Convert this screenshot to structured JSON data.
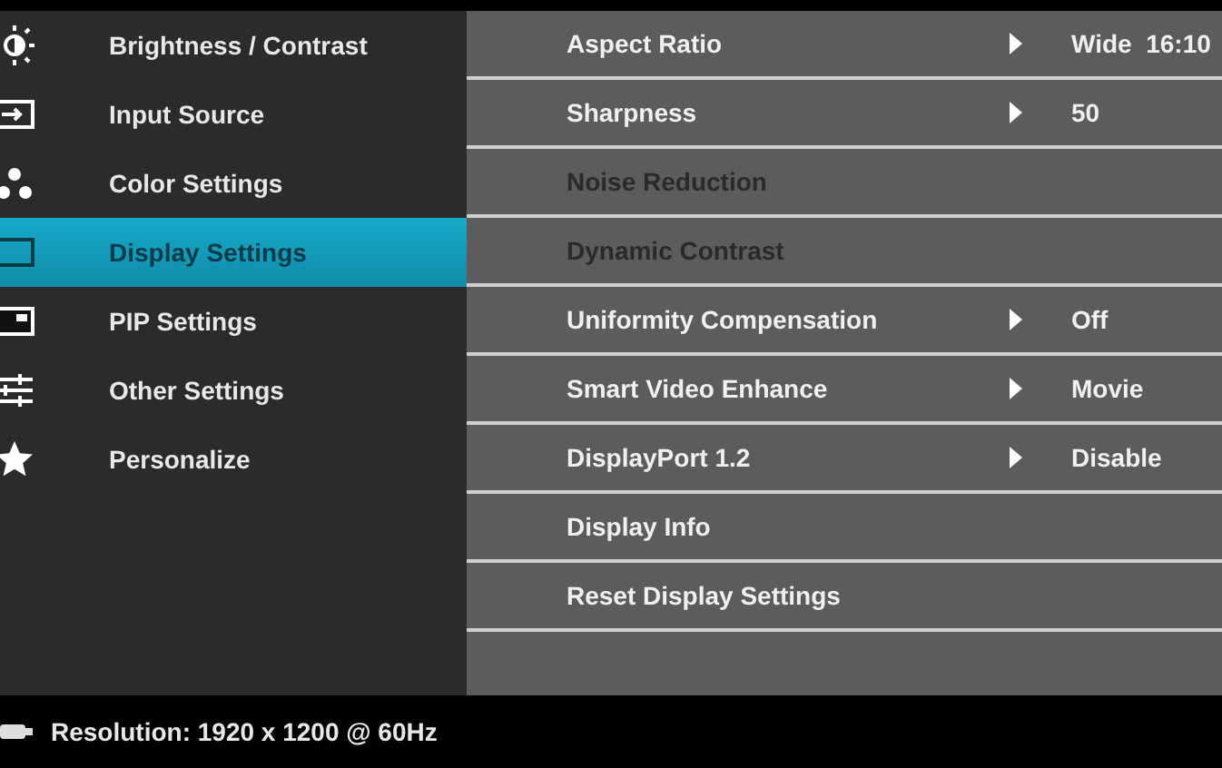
{
  "menu": [
    {
      "label": "Brightness / Contrast",
      "kind": "brightness",
      "selected": false
    },
    {
      "label": "Input Source",
      "kind": "input",
      "selected": false
    },
    {
      "label": "Color Settings",
      "kind": "color",
      "selected": false
    },
    {
      "label": "Display Settings",
      "kind": "display",
      "selected": true
    },
    {
      "label": "PIP Settings",
      "kind": "pip",
      "selected": false
    },
    {
      "label": "Other Settings",
      "kind": "other",
      "selected": false
    },
    {
      "label": "Personalize",
      "kind": "personalize",
      "selected": false
    }
  ],
  "settings": [
    {
      "label": "Aspect Ratio",
      "kind": "option",
      "value": "Wide  16:10",
      "disabled": false
    },
    {
      "label": "Sharpness",
      "kind": "option",
      "value": "50",
      "disabled": false
    },
    {
      "label": "Noise Reduction",
      "kind": "action",
      "disabled": true
    },
    {
      "label": "Dynamic Contrast",
      "kind": "action",
      "disabled": true
    },
    {
      "label": "Uniformity Compensation",
      "kind": "option",
      "value": "Off",
      "disabled": false
    },
    {
      "label": "Smart Video Enhance",
      "kind": "option",
      "value": "Movie",
      "disabled": false
    },
    {
      "label": "DisplayPort 1.2",
      "kind": "option",
      "value": "Disable",
      "disabled": false
    },
    {
      "label": "Display Info",
      "kind": "action",
      "disabled": false
    },
    {
      "label": "Reset Display Settings",
      "kind": "action",
      "disabled": false
    }
  ],
  "status_bar": {
    "text": "Resolution: 1920 x 1200 @ 60Hz"
  }
}
